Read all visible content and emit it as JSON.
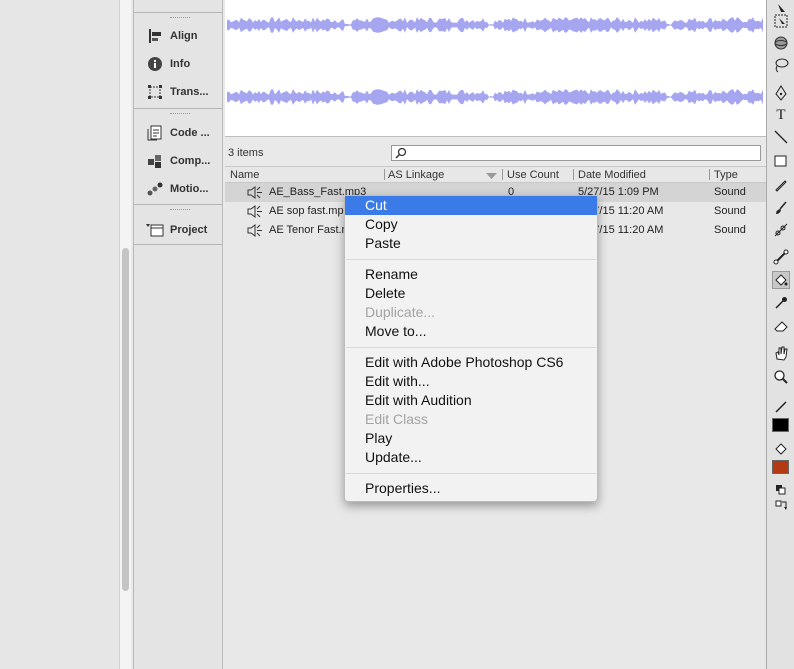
{
  "dock": {
    "items": [
      {
        "label": "Align",
        "icon": "align-icon"
      },
      {
        "label": "Info",
        "icon": "info-icon"
      },
      {
        "label": "Trans...",
        "icon": "transform-icon"
      },
      {
        "label": "Code ...",
        "icon": "code-snippets-icon"
      },
      {
        "label": "Comp...",
        "icon": "components-icon"
      },
      {
        "label": "Motio...",
        "icon": "motion-presets-icon"
      },
      {
        "label": "Project",
        "icon": "project-icon"
      }
    ]
  },
  "library": {
    "item_count": "3 items",
    "search": {
      "value": "",
      "placeholder": ""
    },
    "columns": [
      "Name",
      "AS Linkage",
      "Use Count",
      "Date Modified",
      "Type"
    ],
    "rows": [
      {
        "name": "AE_Bass_Fast.mp3",
        "use_count": "0",
        "date": "5/27/15 1:09 PM",
        "type": "Sound",
        "selected": true
      },
      {
        "name": "AE sop fast.mp3",
        "use_count": "0",
        "date": "5/27/15 11:20 AM",
        "type": "Sound",
        "selected": false
      },
      {
        "name": "AE Tenor Fast.mp3",
        "use_count": "0",
        "date": "5/27/15 11:20 AM",
        "type": "Sound",
        "selected": false
      }
    ]
  },
  "context_menu": {
    "items": [
      {
        "label": "Cut",
        "state": "highlighted"
      },
      {
        "label": "Copy",
        "state": "enabled"
      },
      {
        "label": "Paste",
        "state": "enabled"
      },
      {
        "label": "Rename",
        "state": "enabled"
      },
      {
        "label": "Delete",
        "state": "enabled"
      },
      {
        "label": "Duplicate...",
        "state": "disabled"
      },
      {
        "label": "Move to...",
        "state": "enabled"
      },
      {
        "label": "Edit with Adobe Photoshop CS6",
        "state": "enabled"
      },
      {
        "label": "Edit with...",
        "state": "enabled"
      },
      {
        "label": "Edit with Audition",
        "state": "enabled"
      },
      {
        "label": "Edit Class",
        "state": "disabled"
      },
      {
        "label": "Play",
        "state": "enabled"
      },
      {
        "label": "Update...",
        "state": "enabled"
      },
      {
        "label": "Properties...",
        "state": "enabled"
      }
    ]
  },
  "toolbar": {
    "tools": [
      "subselection-icon",
      "free-transform-icon",
      "3d-rotation-icon",
      "lasso-icon",
      "pen-icon",
      "text-icon",
      "line-icon",
      "rectangle-icon",
      "pencil-icon",
      "brush-icon",
      "deco-icon",
      "bone-icon",
      "paint-bucket-icon",
      "eyedropper-icon",
      "eraser-icon",
      "hand-icon",
      "zoom-icon",
      "stroke-color-icon",
      "fill-color-icon",
      "swap-colors-icon"
    ],
    "stroke_color": "#000000",
    "fill_color": "#b33a12"
  },
  "colors": {
    "waveform": "#a6a6f0",
    "menu_highlight": "#3a7be8"
  }
}
